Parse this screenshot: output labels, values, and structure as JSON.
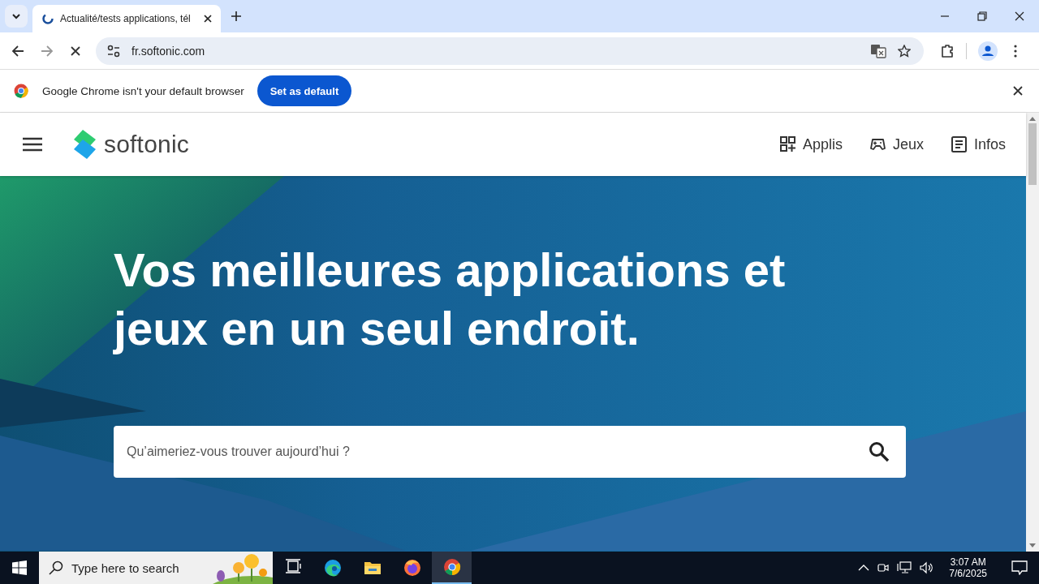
{
  "browser": {
    "tabs": [
      {
        "title": "Actualité/tests applications, tél",
        "selected": true
      }
    ],
    "address": "fr.softonic.com",
    "loading": true
  },
  "infobar": {
    "message": "Google Chrome isn't your default browser",
    "button": "Set as default"
  },
  "site": {
    "logo": "softonic",
    "nav": [
      {
        "label": "Applis",
        "kind": "apps"
      },
      {
        "label": "Jeux",
        "kind": "games"
      },
      {
        "label": "Infos",
        "kind": "news"
      }
    ],
    "headline": "Vos meilleures applications et jeux en un seul endroit.",
    "search_placeholder": "Qu’aimeriez-vous trouver aujourd’hui ?"
  },
  "taskbar": {
    "search_placeholder": "Type here to search",
    "apps": [
      {
        "kind": "taskview",
        "selected": false
      },
      {
        "kind": "edge",
        "selected": false
      },
      {
        "kind": "explorer",
        "selected": false
      },
      {
        "kind": "firefox",
        "selected": false
      },
      {
        "kind": "chrome",
        "selected": true
      }
    ],
    "time": "3:07 AM",
    "date": "7/6/2025"
  }
}
